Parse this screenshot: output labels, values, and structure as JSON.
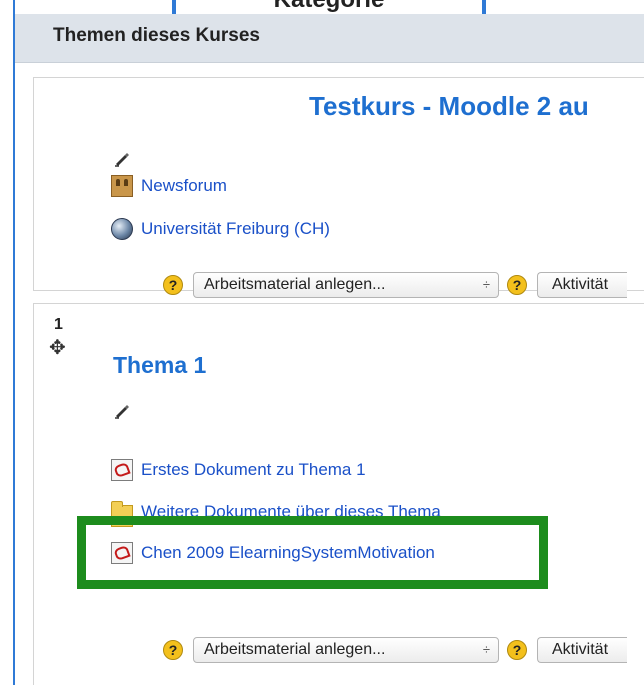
{
  "top_tab": {
    "text": "Kategorie"
  },
  "header": {
    "title": "Themen dieses Kurses"
  },
  "section0": {
    "title": "Testkurs - Moodle 2 au",
    "activities": [
      {
        "label": "Newsforum",
        "icon": "forum-icon"
      },
      {
        "label": "Universität Freiburg (CH)",
        "icon": "url-globe-icon"
      }
    ],
    "add_resource": "Arbeitsmaterial anlegen...",
    "add_activity": "Aktivität",
    "help_symbol": "?",
    "select_arrows": "÷"
  },
  "section1": {
    "number": "1",
    "move_symbol": "✥",
    "title": "Thema 1",
    "activities": [
      {
        "label": "Erstes Dokument zu Thema 1",
        "icon": "pdf-icon"
      },
      {
        "label": "Weitere Dokumente über dieses Thema",
        "icon": "folder-icon"
      },
      {
        "label": "Chen 2009 ElearningSystemMotivation",
        "icon": "pdf-icon"
      }
    ],
    "add_resource": "Arbeitsmaterial anlegen...",
    "add_activity": "Aktivität",
    "help_symbol": "?",
    "select_arrows": "÷"
  },
  "colors": {
    "link": "#1a50c8",
    "title": "#1e6fd0",
    "header_bg": "#dde3ea",
    "highlight": "#1d8c1d",
    "frame": "#2f7ad6"
  }
}
